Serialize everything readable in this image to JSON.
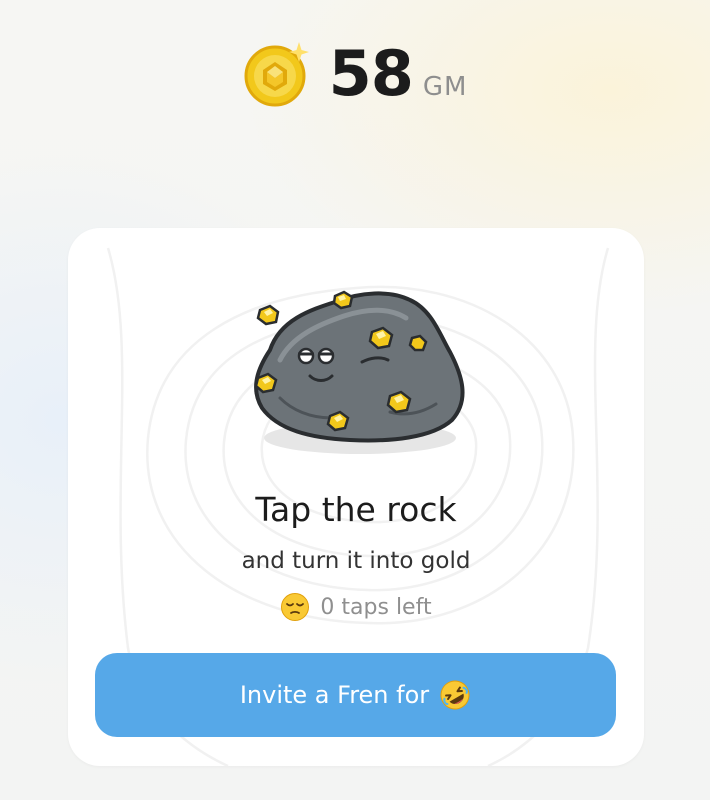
{
  "balance": {
    "amount": "58",
    "unit": "GM",
    "icon": "gold-coin-icon"
  },
  "card": {
    "title": "Tap the rock",
    "subtitle": "and turn it into gold",
    "taps_icon": "pensive-face-emoji",
    "taps_text": "0 taps left",
    "rock_icon": "rock-with-gold-nuggets"
  },
  "invite_button": {
    "label": "Invite a Fren for",
    "emoji_icon": "rolling-on-floor-laughing-emoji"
  },
  "colors": {
    "accent": "#56a8e8",
    "coin_gold": "#f2c81b",
    "text_primary": "#1c1c1c",
    "text_muted": "#8f8f8f"
  }
}
